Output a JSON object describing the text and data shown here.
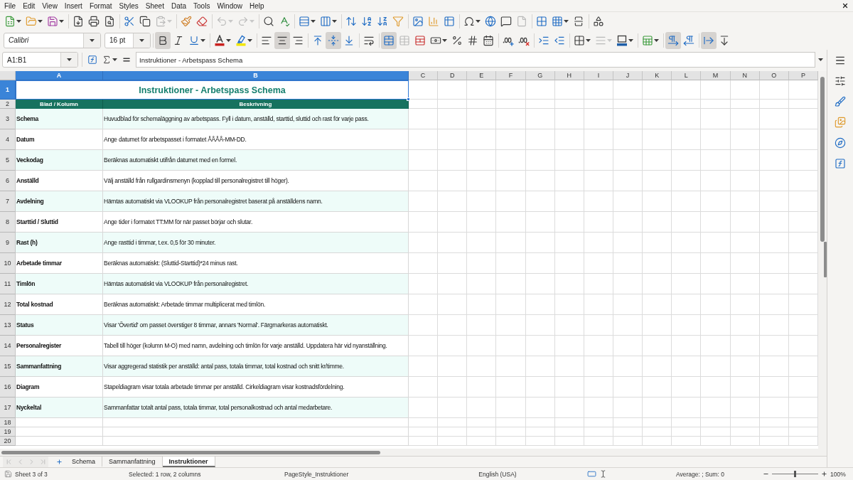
{
  "menu_bar": [
    "File",
    "Edit",
    "View",
    "Insert",
    "Format",
    "Styles",
    "Sheet",
    "Data",
    "Tools",
    "Window",
    "Help"
  ],
  "standard_toolbar": {
    "groups": [
      [
        {
          "kind": "dropdown",
          "disabled": false
        },
        {
          "kind": "dropdown",
          "disabled": false
        },
        {
          "kind": "dropdown",
          "disabled": false
        }
      ],
      [
        {
          "kind": "button",
          "disabled": false
        },
        {
          "kind": "button",
          "disabled": false
        },
        {
          "kind": "button",
          "disabled": false
        }
      ],
      [
        {
          "kind": "button",
          "disabled": false
        },
        {
          "kind": "button",
          "disabled": false
        },
        {
          "kind": "dropdown",
          "disabled": true
        }
      ],
      [
        {
          "kind": "button",
          "disabled": false
        },
        {
          "kind": "button",
          "disabled": false
        }
      ],
      [
        {
          "kind": "dropdown",
          "disabled": true
        },
        {
          "kind": "dropdown",
          "disabled": true
        }
      ],
      [
        {
          "kind": "button",
          "disabled": false
        },
        {
          "kind": "button",
          "disabled": false
        }
      ],
      [
        {
          "kind": "dropdown",
          "disabled": false
        },
        {
          "kind": "dropdown",
          "disabled": false
        }
      ],
      [
        {
          "kind": "button",
          "disabled": false
        },
        {
          "kind": "button",
          "disabled": false
        },
        {
          "kind": "button",
          "disabled": false
        },
        {
          "kind": "button",
          "disabled": false
        }
      ],
      [
        {
          "kind": "button",
          "disabled": false
        },
        {
          "kind": "button",
          "disabled": false
        },
        {
          "kind": "button",
          "disabled": false
        }
      ],
      [
        {
          "kind": "dropdown",
          "disabled": false
        },
        {
          "kind": "button",
          "disabled": false
        },
        {
          "kind": "button",
          "disabled": false
        },
        {
          "kind": "button",
          "disabled": true
        }
      ],
      [
        {
          "kind": "button",
          "disabled": false
        },
        {
          "kind": "dropdown",
          "disabled": false
        },
        {
          "kind": "button",
          "disabled": false
        }
      ],
      [
        {
          "kind": "button",
          "disabled": false
        }
      ]
    ]
  },
  "formatting_toolbar": {
    "font_name": "Calibri",
    "font_size": "16 pt",
    "groups": [
      [
        {
          "kind": "button",
          "pressed": true,
          "disabled": false
        },
        {
          "kind": "button",
          "pressed": false,
          "disabled": false
        },
        {
          "kind": "dropdown",
          "pressed": false,
          "disabled": false
        }
      ],
      [
        {
          "kind": "dropdown",
          "pressed": false,
          "disabled": false
        },
        {
          "kind": "dropdown",
          "pressed": false,
          "disabled": false
        }
      ],
      [
        {
          "kind": "button",
          "pressed": false,
          "disabled": false
        },
        {
          "kind": "button",
          "pressed": true,
          "disabled": false
        },
        {
          "kind": "button",
          "pressed": false,
          "disabled": false
        }
      ],
      [
        {
          "kind": "button",
          "pressed": false,
          "disabled": false
        },
        {
          "kind": "button",
          "pressed": true,
          "disabled": false
        },
        {
          "kind": "button",
          "pressed": false,
          "disabled": false
        }
      ],
      [
        {
          "kind": "button",
          "pressed": false,
          "disabled": false
        }
      ],
      [
        {
          "kind": "button",
          "pressed": true,
          "disabled": false
        },
        {
          "kind": "button",
          "pressed": false,
          "disabled": true
        },
        {
          "kind": "button",
          "pressed": false,
          "disabled": false
        },
        {
          "kind": "dropdown",
          "pressed": false,
          "disabled": false
        },
        {
          "kind": "button",
          "pressed": false,
          "disabled": false
        },
        {
          "kind": "button",
          "pressed": false,
          "disabled": false
        },
        {
          "kind": "button",
          "pressed": false,
          "disabled": false
        }
      ],
      [
        {
          "kind": "button",
          "pressed": false,
          "disabled": false
        },
        {
          "kind": "button",
          "pressed": false,
          "disabled": false
        }
      ],
      [
        {
          "kind": "button",
          "pressed": false,
          "disabled": false
        },
        {
          "kind": "button",
          "pressed": false,
          "disabled": false
        }
      ],
      [
        {
          "kind": "dropdown",
          "pressed": false,
          "disabled": false
        },
        {
          "kind": "dropdown",
          "pressed": false,
          "disabled": true
        },
        {
          "kind": "dropdown",
          "pressed": false,
          "disabled": false
        }
      ],
      [
        {
          "kind": "dropdown",
          "pressed": false,
          "disabled": false
        }
      ],
      [
        {
          "kind": "button",
          "pressed": true,
          "disabled": false
        },
        {
          "kind": "button",
          "pressed": false,
          "disabled": false
        }
      ],
      [
        {
          "kind": "button",
          "pressed": true,
          "disabled": false
        },
        {
          "kind": "button",
          "pressed": false,
          "disabled": false
        }
      ]
    ]
  },
  "formula_bar": {
    "name_box": "A1:B1",
    "formula": "Instruktioner - Arbetspass Schema"
  },
  "sheet": {
    "columns": [
      {
        "label": "A",
        "selected": true
      },
      {
        "label": "B",
        "selected": true
      },
      {
        "label": "C",
        "selected": false
      },
      {
        "label": "D",
        "selected": false
      },
      {
        "label": "E",
        "selected": false
      },
      {
        "label": "F",
        "selected": false
      },
      {
        "label": "G",
        "selected": false
      },
      {
        "label": "H",
        "selected": false
      },
      {
        "label": "I",
        "selected": false
      },
      {
        "label": "J",
        "selected": false
      },
      {
        "label": "K",
        "selected": false
      },
      {
        "label": "L",
        "selected": false
      },
      {
        "label": "M",
        "selected": false
      },
      {
        "label": "N",
        "selected": false
      },
      {
        "label": "O",
        "selected": false
      },
      {
        "label": "P",
        "selected": false
      }
    ],
    "rows": [
      {
        "label": "1",
        "selected": true
      },
      {
        "label": "2",
        "selected": false
      },
      {
        "label": "3",
        "selected": false
      },
      {
        "label": "4",
        "selected": false
      },
      {
        "label": "5",
        "selected": false
      },
      {
        "label": "6",
        "selected": false
      },
      {
        "label": "7",
        "selected": false
      },
      {
        "label": "8",
        "selected": false
      },
      {
        "label": "9",
        "selected": false
      },
      {
        "label": "10",
        "selected": false
      },
      {
        "label": "11",
        "selected": false
      },
      {
        "label": "12",
        "selected": false
      },
      {
        "label": "13",
        "selected": false
      },
      {
        "label": "14",
        "selected": false
      },
      {
        "label": "15",
        "selected": false
      },
      {
        "label": "16",
        "selected": false
      },
      {
        "label": "17",
        "selected": false
      },
      {
        "label": "18",
        "selected": false
      },
      {
        "label": "19",
        "selected": false
      },
      {
        "label": "20",
        "selected": false
      }
    ],
    "title": "Instruktioner - Arbetspass Schema",
    "header": [
      "Blad / Kolumn",
      "Beskrivning"
    ],
    "entries": [
      {
        "item": "Schema",
        "description": "Huvudblad för schemaläggning av arbetspass. Fyll i datum, anställd, starttid, sluttid och rast för varje pass."
      },
      {
        "item": "Datum",
        "description": "Ange datumet för arbetspasset i formatet ÅÅÅÅ-MM-DD."
      },
      {
        "item": "Veckodag",
        "description": "Beräknas automatiskt utifrån datumet med en formel."
      },
      {
        "item": "Anställd",
        "description": "Välj anställd från rullgardinsmenyn (kopplad till personalregistret till höger)."
      },
      {
        "item": "Avdelning",
        "description": "Hämtas automatiskt via VLOOKUP från personalregistret baserat på anställdens namn."
      },
      {
        "item": "Starttid / Sluttid",
        "description": "Ange tider i formatet TT:MM för när passet börjar och slutar."
      },
      {
        "item": "Rast (h)",
        "description": "Ange rasttid i timmar, t.ex. 0,5 för 30 minuter."
      },
      {
        "item": "Arbetade timmar",
        "description": "Beräknas automatiskt: (Sluttid-Starttid)*24 minus rast."
      },
      {
        "item": "Timlön",
        "description": "Hämtas automatiskt via VLOOKUP från personalregistret."
      },
      {
        "item": "Total kostnad",
        "description": "Beräknas automatiskt: Arbetade timmar multiplicerat med timlön."
      },
      {
        "item": "Status",
        "description": "Visar 'Övertid' om passet överstiger 8 timmar, annars 'Normal'. Färgmarkeras automatiskt."
      },
      {
        "item": "Personalregister",
        "description": "Tabell till höger (kolumn M-O) med namn, avdelning och timlön för varje anställd. Uppdatera här vid nyanställning."
      },
      {
        "item": "Sammanfattning",
        "description": "Visar aggregerad statistik per anställd: antal pass, totala timmar, total kostnad och snitt kr/timme."
      },
      {
        "item": "Diagram",
        "description": "Stapeldiagram visar totala arbetade timmar per anställd. Cirkeldiagram visar kostnadsfördelning."
      },
      {
        "item": "Nyckeltal",
        "description": "Sammanfattar totalt antal pass, totala timmar, total personalkostnad och antal medarbetare."
      }
    ]
  },
  "sheet_tabs": [
    {
      "label": "Schema",
      "selected": false
    },
    {
      "label": "Sammanfattning",
      "selected": false
    },
    {
      "label": "Instruktioner",
      "selected": true
    }
  ],
  "status_bar": {
    "sheet": "Sheet 3 of 3",
    "selection": "Selected: 1 row, 2 columns",
    "page_style": "PageStyle_Instruktioner",
    "language": "English (USA)",
    "summary": "Average: ; Sum: 0",
    "zoom": {
      "level": 0.5,
      "label": "100%"
    }
  }
}
